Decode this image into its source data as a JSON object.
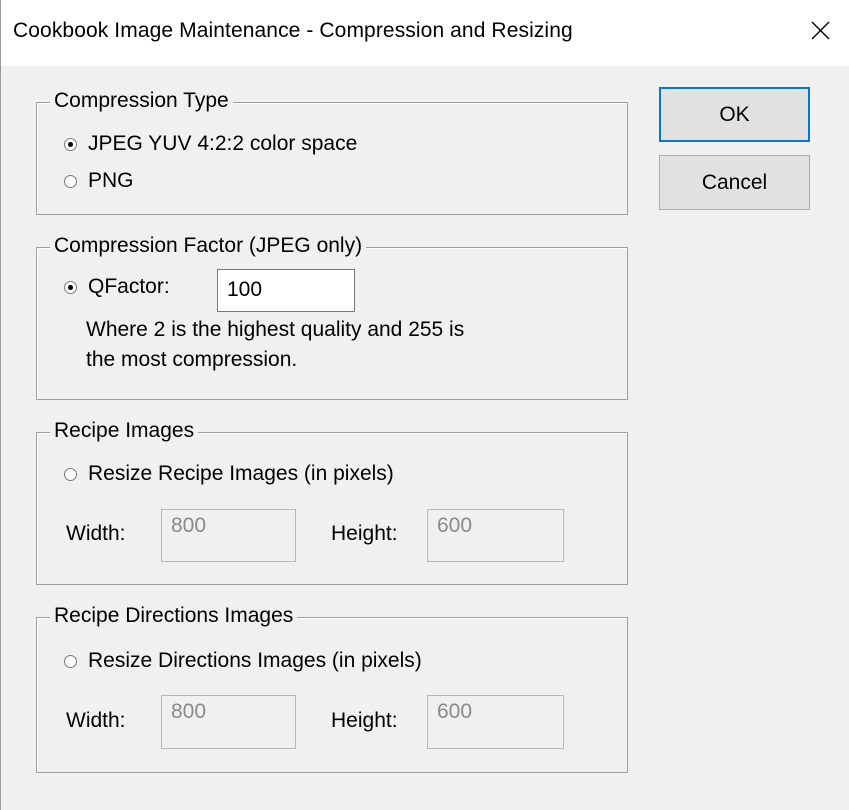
{
  "window": {
    "title": "Cookbook Image Maintenance - Compression and Resizing",
    "close_icon": "close-icon"
  },
  "compression_type": {
    "legend": "Compression Type",
    "options": [
      {
        "label": "JPEG YUV 4:2:2 color space",
        "checked": true
      },
      {
        "label": "PNG",
        "checked": false
      }
    ]
  },
  "compression_factor": {
    "legend": "Compression Factor (JPEG only)",
    "qfactor_label": "QFactor:",
    "qfactor_checked": true,
    "qfactor_value": "100",
    "help_line1": "Where 2 is the highest quality and 255 is",
    "help_line2": "the most compression."
  },
  "recipe_images": {
    "legend": "Recipe Images",
    "resize_label": "Resize Recipe Images (in pixels)",
    "resize_checked": false,
    "width_label": "Width:",
    "width_value": "800",
    "height_label": "Height:",
    "height_value": "600"
  },
  "directions_images": {
    "legend": "Recipe Directions Images",
    "resize_label": "Resize Directions Images (in pixels)",
    "resize_checked": false,
    "width_label": "Width:",
    "width_value": "800",
    "height_label": "Height:",
    "height_value": "600"
  },
  "buttons": {
    "ok_label": "OK",
    "cancel_label": "Cancel"
  },
  "colors": {
    "dialog_bg": "#f0f0f0",
    "default_button_border": "#0078d7"
  }
}
